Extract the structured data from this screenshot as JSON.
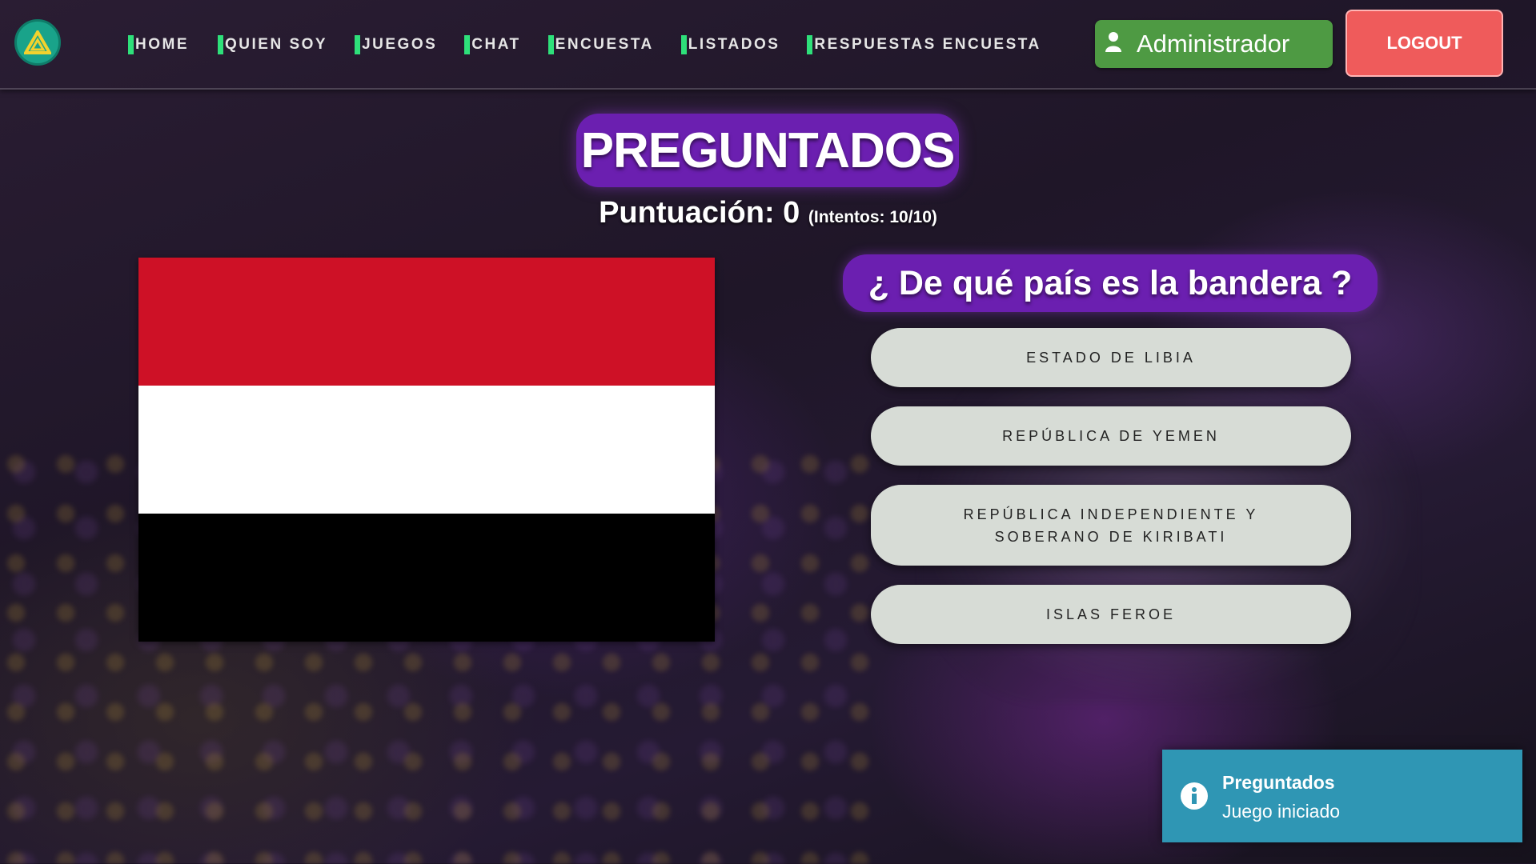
{
  "navbar": {
    "logo_icon": "triangle-logo-icon",
    "links": [
      "HOME",
      "QUIEN SOY",
      "JUEGOS",
      "CHAT",
      "ENCUESTA",
      "LISTADOS",
      "RESPUESTAS ENCUESTA"
    ],
    "user_label": "Administrador",
    "logout_label": "LOGOUT"
  },
  "game": {
    "title": "PREGUNTADOS",
    "score_label": "Puntuación: 0",
    "attempts_label": "(Intentos: 10/10)",
    "flag_colors": [
      "#ce1126",
      "#ffffff",
      "#000000"
    ],
    "question": "¿ De qué país es la bandera ?",
    "options": [
      "ESTADO DE LIBIA",
      "REPÚBLICA DE YEMEN",
      "REPÚBLICA INDEPENDIENTE Y SOBERANO DE KIRIBATI",
      "ISLAS FEROE"
    ]
  },
  "toast": {
    "title": "Preguntados",
    "message": "Juego iniciado",
    "icon": "info-icon"
  },
  "colors": {
    "accent_purple": "#6b1fb0",
    "nav_marker_green": "#2ee07a",
    "admin_green": "#4e9a43",
    "logout_red": "#ef5b5b",
    "toast_blue": "#2f96b4"
  }
}
